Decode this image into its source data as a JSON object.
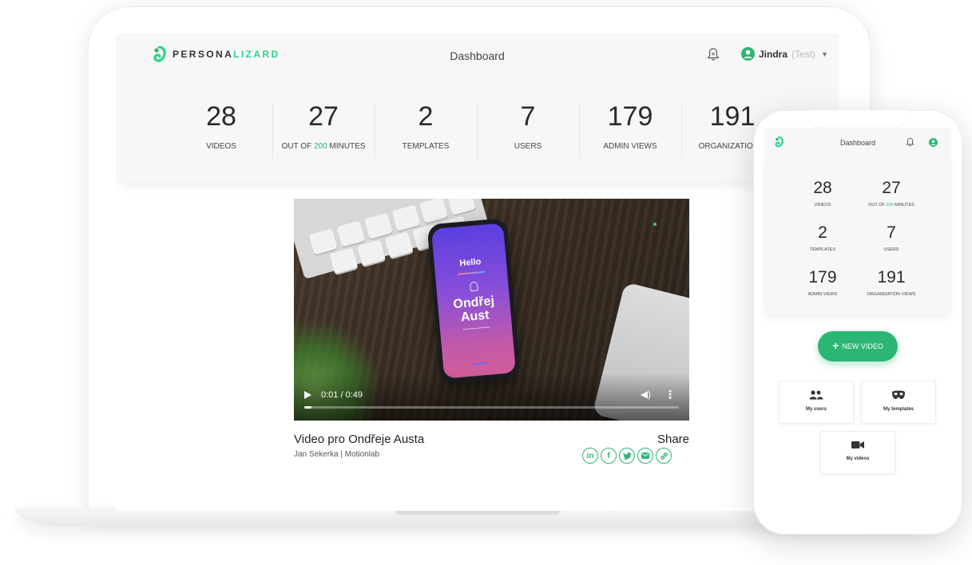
{
  "brand": {
    "name_a": "PERSONA",
    "name_b": "LIZARD",
    "accent": "#2bd48c",
    "green": "#2bb673"
  },
  "header": {
    "title": "Dashboard",
    "user_name": "Jindra",
    "user_note": "(Test)"
  },
  "stats": [
    {
      "value": "28",
      "label": "VIDEOS"
    },
    {
      "value": "27",
      "label_pre": "OUT OF ",
      "label_highlight": "200",
      "label_post": " MINUTES"
    },
    {
      "value": "2",
      "label": "TEMPLATES"
    },
    {
      "value": "7",
      "label": "USERS"
    },
    {
      "value": "179",
      "label": "ADMIN VIEWS"
    },
    {
      "value": "191",
      "label": "ORGANIZATION V"
    }
  ],
  "video": {
    "screen_hello": "Hello",
    "screen_name": "Ondřej Aust",
    "time": "0:01 / 0:49",
    "progress_fraction": 0.02,
    "title": "Video pro Ondřeje Austa",
    "author": "Jan Sekerka | Motionlab",
    "share_label": "Share",
    "share_icons": [
      "linkedin-icon",
      "facebook-icon",
      "twitter-icon",
      "email-icon",
      "link-icon"
    ]
  },
  "mobile": {
    "title": "Dashboard",
    "stats": [
      {
        "value": "28",
        "label": "VIDEOS"
      },
      {
        "value": "27",
        "label_pre": "OUT OF ",
        "label_highlight": "200",
        "label_post": " MINUTES"
      },
      {
        "value": "2",
        "label": "TEMPLATES"
      },
      {
        "value": "7",
        "label": "USERS"
      },
      {
        "value": "179",
        "label": "ADMIN VIEWS"
      },
      {
        "value": "191",
        "label": "ORGANIZATION VIEWS"
      }
    ],
    "new_video": "NEW VIDEO",
    "tiles": [
      {
        "label": "My users",
        "icon": "users-icon"
      },
      {
        "label": "My templates",
        "icon": "mask-icon"
      },
      {
        "label": "My videos",
        "icon": "video-camera-icon"
      }
    ]
  }
}
